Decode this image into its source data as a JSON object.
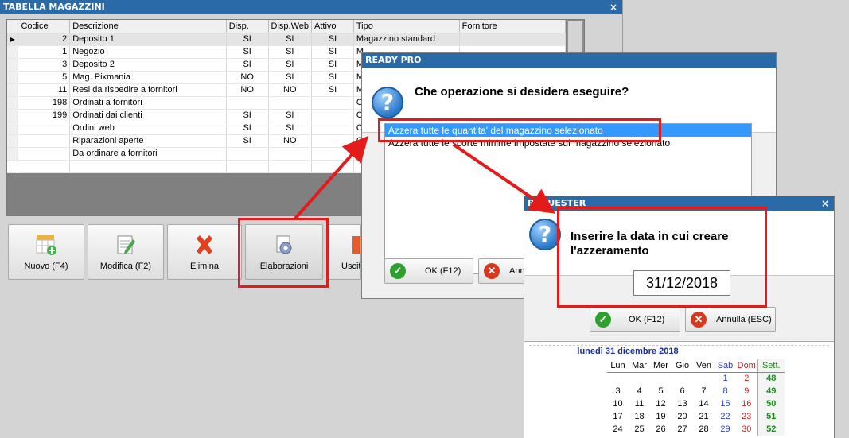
{
  "main": {
    "title": "TABELLA MAGAZZINI",
    "close": "×",
    "columns": [
      "Codice",
      "Descrizione",
      "Disp.",
      "Disp.Web",
      "Attivo",
      "Tipo",
      "Fornitore"
    ],
    "rows": [
      {
        "codice": "2",
        "descrizione": "Deposito 1",
        "disp": "SI",
        "web": "SI",
        "attivo": "SI",
        "tipo": "Magazzino standard",
        "fornitore": ""
      },
      {
        "codice": "1",
        "descrizione": "Negozio",
        "disp": "SI",
        "web": "SI",
        "attivo": "SI",
        "tipo": "M",
        "fornitore": ""
      },
      {
        "codice": "3",
        "descrizione": "Deposito 2",
        "disp": "SI",
        "web": "SI",
        "attivo": "SI",
        "tipo": "M",
        "fornitore": ""
      },
      {
        "codice": "5",
        "descrizione": "Mag. Pixmania",
        "disp": "NO",
        "web": "SI",
        "attivo": "SI",
        "tipo": "M",
        "fornitore": ""
      },
      {
        "codice": "11",
        "descrizione": "Resi da rispedire a fornitori",
        "disp": "NO",
        "web": "NO",
        "attivo": "SI",
        "tipo": "M",
        "fornitore": ""
      },
      {
        "codice": "198",
        "descrizione": "Ordinati a fornitori",
        "disp": "",
        "web": "",
        "attivo": "",
        "tipo": "O",
        "fornitore": ""
      },
      {
        "codice": "199",
        "descrizione": "Ordinati dai clienti",
        "disp": "SI",
        "web": "SI",
        "attivo": "",
        "tipo": "O",
        "fornitore": ""
      },
      {
        "codice": "",
        "descrizione": "Ordini web",
        "disp": "SI",
        "web": "SI",
        "attivo": "",
        "tipo": "O",
        "fornitore": ""
      },
      {
        "codice": "",
        "descrizione": "Riparazioni aperte",
        "disp": "SI",
        "web": "NO",
        "attivo": "",
        "tipo": "O",
        "fornitore": ""
      },
      {
        "codice": "",
        "descrizione": "Da ordinare a fornitori",
        "disp": "",
        "web": "",
        "attivo": "",
        "tipo": "",
        "fornitore": ""
      }
    ],
    "buttons": {
      "nuovo": "Nuovo (F4)",
      "modifica": "Modifica (F2)",
      "elimina": "Elimina",
      "elaborazioni": "Elaborazioni",
      "uscita": "Uscita"
    }
  },
  "dialog1": {
    "title": "READY PRO",
    "question": "Che operazione si desidera eseguire?",
    "options": [
      "Azzera tutte le quantita' del magazzino selezionato",
      "Azzera tutte le scorte minime impostate sul magazzino selezionato"
    ],
    "ok": "OK (F12)",
    "cancel": "Annulla (ESC)"
  },
  "dialog2": {
    "title": "REQUESTER",
    "close": "×",
    "question": "Inserire la data in cui creare l'azzeramento",
    "date_value": "31/12/2018",
    "ok": "OK (F12)",
    "cancel": "Annulla (ESC)",
    "calendar": {
      "title": "lunedì 31 dicembre 2018",
      "days": [
        "Lun",
        "Mar",
        "Mer",
        "Gio",
        "Ven",
        "Sab",
        "Dom"
      ],
      "week_label": "Sett.",
      "weeks": [
        {
          "n": "48",
          "d": [
            "",
            "",
            "",
            "",
            "",
            "1",
            "2"
          ]
        },
        {
          "n": "49",
          "d": [
            "3",
            "4",
            "5",
            "6",
            "7",
            "8",
            "9"
          ]
        },
        {
          "n": "50",
          "d": [
            "10",
            "11",
            "12",
            "13",
            "14",
            "15",
            "16"
          ]
        },
        {
          "n": "51",
          "d": [
            "17",
            "18",
            "19",
            "20",
            "21",
            "22",
            "23"
          ]
        },
        {
          "n": "52",
          "d": [
            "24",
            "25",
            "26",
            "27",
            "28",
            "29",
            "30"
          ]
        }
      ]
    }
  },
  "colors": {
    "annotation": "#e31b1b",
    "titlebar": "#2b6aa8",
    "selection": "#3399ff"
  }
}
